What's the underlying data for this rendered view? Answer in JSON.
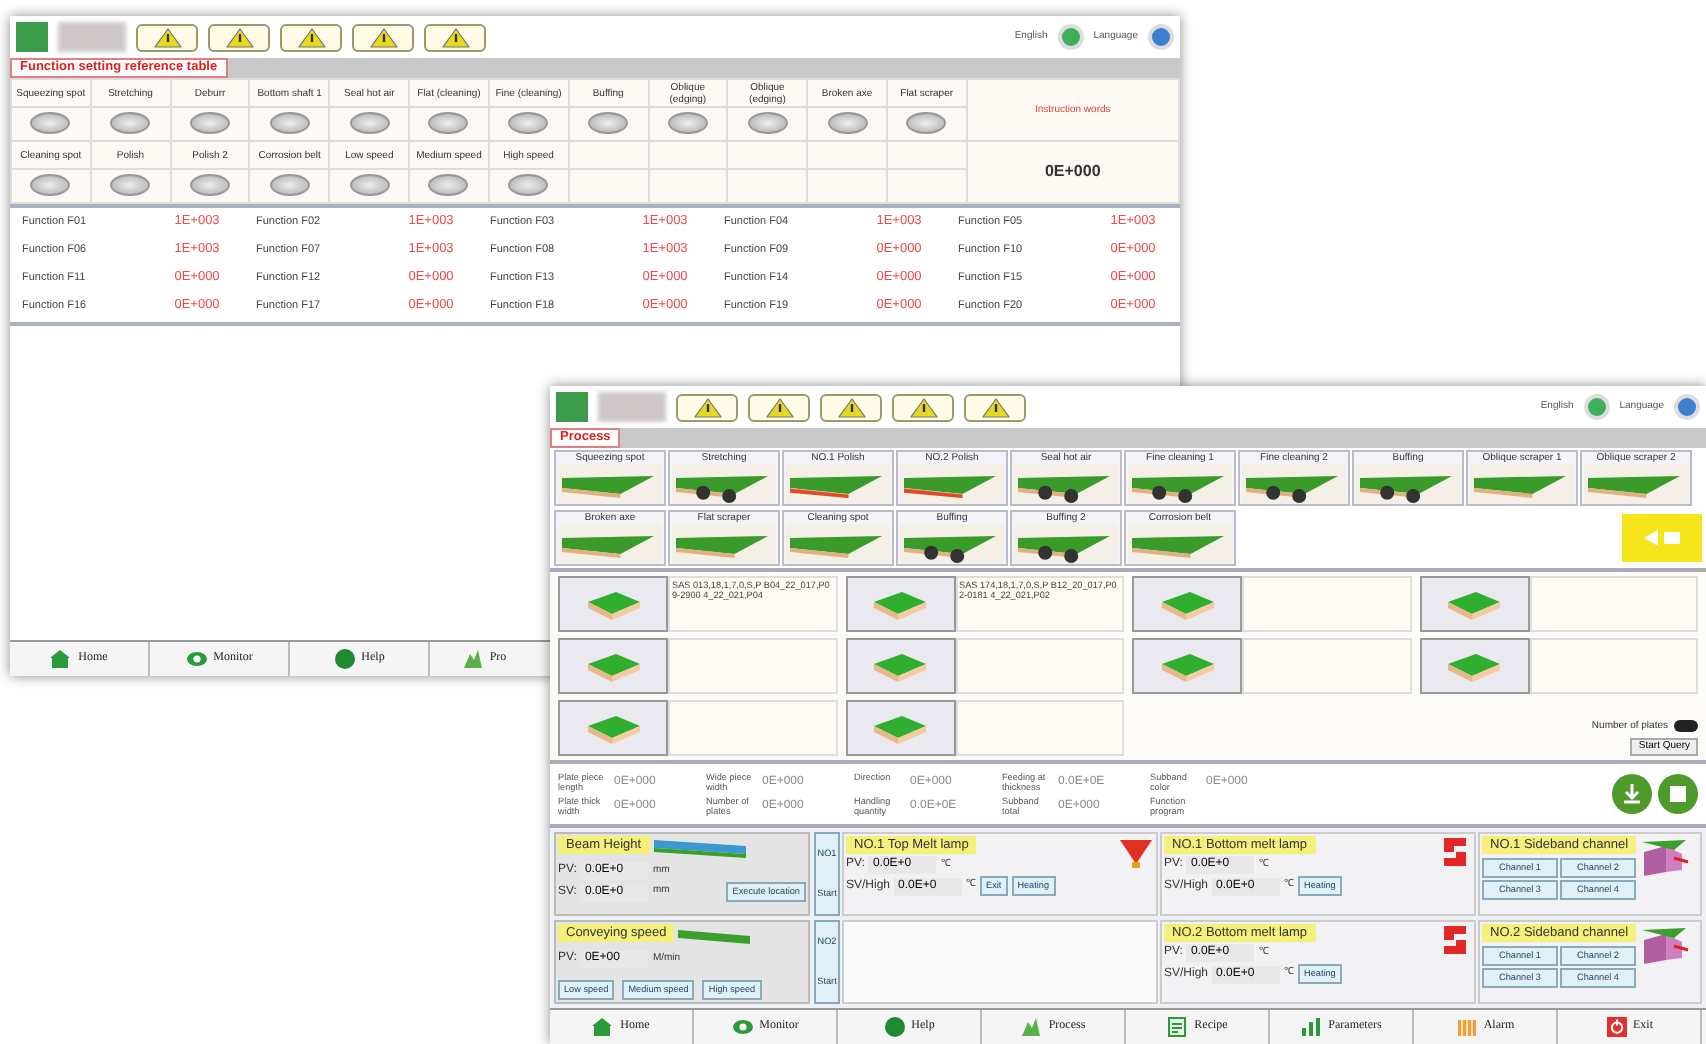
{
  "settings_window": {
    "header": {
      "languages": [
        {
          "label": "English",
          "color": "#3fae5a"
        },
        {
          "label": "Language",
          "color": "#3a7fd0"
        }
      ]
    },
    "tab": {
      "label": "Function setting reference table",
      "selected": true
    },
    "function_lamps": [
      [
        {
          "label": "Squeezing spot",
          "on": false
        },
        {
          "label": "Stretching",
          "on": false
        },
        {
          "label": "Deburr",
          "on": false
        },
        {
          "label": "Bottom shaft 1",
          "on": false
        },
        {
          "label": "Seal hot air",
          "on": false
        },
        {
          "label": "Flat (cleaning)",
          "on": false
        },
        {
          "label": "Fine (cleaning)",
          "on": false
        },
        {
          "label": "Buffing",
          "on": false
        },
        {
          "label": "Oblique (edging)",
          "on": false
        },
        {
          "label": "Oblique (edging)",
          "on": false
        },
        {
          "label": "Broken axe",
          "on": false
        },
        {
          "label": "Flat scraper",
          "on": false
        }
      ],
      [
        {
          "label": "Cleaning spot",
          "on": false
        },
        {
          "label": "Polish",
          "on": false
        },
        {
          "label": "Polish 2",
          "on": false
        },
        {
          "label": "Corrosion belt",
          "on": false
        },
        {
          "label": "Low speed",
          "on": false
        },
        {
          "label": "Medium speed",
          "on": false
        },
        {
          "label": "High speed",
          "on": false
        }
      ]
    ],
    "instruction": {
      "label": "Instruction words",
      "value": "0E+000"
    },
    "functions": [
      {
        "label": "Function F01",
        "value": "1E+003"
      },
      {
        "label": "Function F02",
        "value": "1E+003"
      },
      {
        "label": "Function F03",
        "value": "1E+003"
      },
      {
        "label": "Function F04",
        "value": "1E+003"
      },
      {
        "label": "Function F05",
        "value": "1E+003"
      },
      {
        "label": "Function F06",
        "value": "1E+003"
      },
      {
        "label": "Function F07",
        "value": "1E+003"
      },
      {
        "label": "Function F08",
        "value": "1E+003"
      },
      {
        "label": "Function F09",
        "value": "0E+000"
      },
      {
        "label": "Function F10",
        "value": "0E+000"
      },
      {
        "label": "Function F11",
        "value": "0E+000"
      },
      {
        "label": "Function F12",
        "value": "0E+000"
      },
      {
        "label": "Function F13",
        "value": "0E+000"
      },
      {
        "label": "Function F14",
        "value": "0E+000"
      },
      {
        "label": "Function F15",
        "value": "0E+000"
      },
      {
        "label": "Function F16",
        "value": "0E+000"
      },
      {
        "label": "Function F17",
        "value": "0E+000"
      },
      {
        "label": "Function F18",
        "value": "0E+000"
      },
      {
        "label": "Function F19",
        "value": "0E+000"
      },
      {
        "label": "Function F20",
        "value": "0E+000"
      }
    ],
    "nav": [
      "Home",
      "Monitor",
      "Help",
      "Pro"
    ]
  },
  "process_window": {
    "header": {
      "languages": [
        {
          "label": "English",
          "color": "#3fae5a"
        },
        {
          "label": "Language",
          "color": "#3a7fd0"
        }
      ]
    },
    "tab": {
      "label": "Process",
      "selected": true
    },
    "process_rows": [
      [
        {
          "label": "Squeezing spot",
          "kind": "plain"
        },
        {
          "label": "Stretching",
          "kind": "rollers"
        },
        {
          "label": "NO.1 Polish",
          "kind": "red"
        },
        {
          "label": "NO.2 Polish",
          "kind": "red"
        },
        {
          "label": "Seal hot air",
          "kind": "rollers"
        },
        {
          "label": "Fine cleaning 1",
          "kind": "rollers"
        },
        {
          "label": "Fine cleaning 2",
          "kind": "rollers"
        },
        {
          "label": "Buffing",
          "kind": "rollers"
        },
        {
          "label": "Oblique scraper 1",
          "kind": "plain"
        },
        {
          "label": "Oblique scraper 2",
          "kind": "plain"
        }
      ],
      [
        {
          "label": "Broken axe",
          "kind": "plain"
        },
        {
          "label": "Flat scraper",
          "kind": "plain"
        },
        {
          "label": "Cleaning spot",
          "kind": "plain"
        },
        {
          "label": "Buffing",
          "kind": "rollers"
        },
        {
          "label": "Buffing 2",
          "kind": "rollers"
        },
        {
          "label": "Corrosion belt",
          "kind": "plain"
        }
      ]
    ],
    "boards": [
      {
        "kind": "labelled",
        "text": "SAS 013,18,1,7,0,S,P B04_22_017,P09-2900 4_22_021,P04"
      },
      {
        "kind": "labelled",
        "text": "SAS 174,18,1,7,0,S,P B12_20_017,P02-0181 4_22_021,P02"
      },
      {
        "kind": "blank"
      },
      {
        "kind": "blank"
      },
      {
        "kind": "blank"
      },
      {
        "kind": "blank"
      },
      {
        "kind": "blank"
      },
      {
        "kind": "blank"
      },
      {
        "kind": "blank"
      },
      {
        "kind": "blank"
      }
    ],
    "plate_count": {
      "label": "Number of plates",
      "on": true
    },
    "query_button": "Start Query",
    "parameters": [
      {
        "label": "Plate piece length",
        "value": "0E+000"
      },
      {
        "label": "Wide piece width",
        "value": "0E+000"
      },
      {
        "label": "Direction",
        "value": "0E+000"
      },
      {
        "label": "Feeding at thickness",
        "value": "0.0E+0E"
      },
      {
        "label": "Subband color",
        "value": "0E+000"
      },
      {
        "label": "Plate thick width",
        "value": "0E+000"
      },
      {
        "label": "Number of plates",
        "value": "0E+000"
      },
      {
        "label": "Handling quantity",
        "value": "0.0E+0E"
      },
      {
        "label": "Subband total",
        "value": "0E+000"
      },
      {
        "label": "Function program"
      }
    ],
    "beam": {
      "title": "Beam Height",
      "pv_label": "PV:",
      "pv": "0.0E+0",
      "pv_unit": "mm",
      "sv_label": "SV:",
      "sv": "0.0E+0",
      "sv_unit": "mm",
      "button": "Execute location"
    },
    "conveying": {
      "title": "Conveying speed",
      "pv_label": "PV:",
      "pv": "0E+00",
      "unit": "M/min",
      "buttons": [
        "Low speed",
        "Medium speed",
        "High speed"
      ]
    },
    "stations": [
      {
        "start": [
          "NO1",
          "Start"
        ],
        "lamps": [
          {
            "kind": "top",
            "title": "NO.1 Top Melt lamp",
            "pv_label": "PV:",
            "pv": "0.0E+0",
            "sv_label": "SV/High",
            "sv": "0.0E+0",
            "unit": "℃",
            "buttons": [
              "Exit",
              "Heating"
            ]
          },
          {
            "kind": "bottom",
            "title": "NO.1 Bottom melt lamp",
            "pv_label": "PV:",
            "pv": "0.0E+0",
            "sv_label": "SV/High",
            "sv": "0.0E+0",
            "unit": "℃",
            "buttons": [
              "Heating"
            ]
          }
        ],
        "channel": {
          "title": "NO.1 Sideband channel",
          "channels": [
            "Channel 1",
            "Channel 2",
            "Channel 3",
            "Channel 4"
          ]
        }
      },
      {
        "start": [
          "NO2",
          "Start"
        ],
        "lamps": [
          {
            "kind": "bottom",
            "title": "NO.2 Bottom melt lamp",
            "pv_label": "PV:",
            "pv": "0.0E+0",
            "sv_label": "SV/High",
            "sv": "0.0E+0",
            "unit": "℃",
            "buttons": [
              "Heating"
            ]
          }
        ],
        "channel": {
          "title": "NO.2 Sideband channel",
          "channels": [
            "Channel 1",
            "Channel 2",
            "Channel 3",
            "Channel 4"
          ]
        }
      }
    ],
    "nav": [
      "Home",
      "Monitor",
      "Help",
      "Process",
      "Recipe",
      "Parameters",
      "Alarm",
      "Exit"
    ]
  }
}
